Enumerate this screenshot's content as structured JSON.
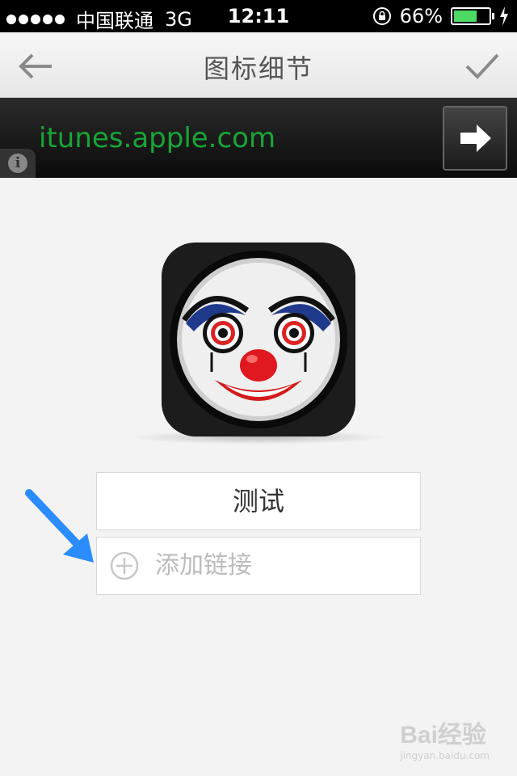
{
  "status_bar": {
    "carrier": "中国联通",
    "network": "3G",
    "time": "12:11",
    "battery": "66%",
    "battery_level": 0.66,
    "battery_color": "#4cd964"
  },
  "nav": {
    "title": "图标细节",
    "back_icon": "back-arrow-icon",
    "confirm_icon": "checkmark-icon"
  },
  "url_bar": {
    "url": "itunes.apple.com",
    "url_color": "#19a535",
    "info_icon": "info-icon",
    "go_icon": "right-arrow-icon"
  },
  "app": {
    "icon": "clown-face-icon",
    "name": "测试",
    "add_link_label": "添加链接",
    "add_link_icon": "plus-circle-icon"
  },
  "annotation": {
    "arrow_icon": "blue-pointer-arrow",
    "arrow_color": "#2a8cff"
  },
  "watermark": {
    "brand": "Bai经验",
    "sub": "jingyan.baidu.com"
  }
}
